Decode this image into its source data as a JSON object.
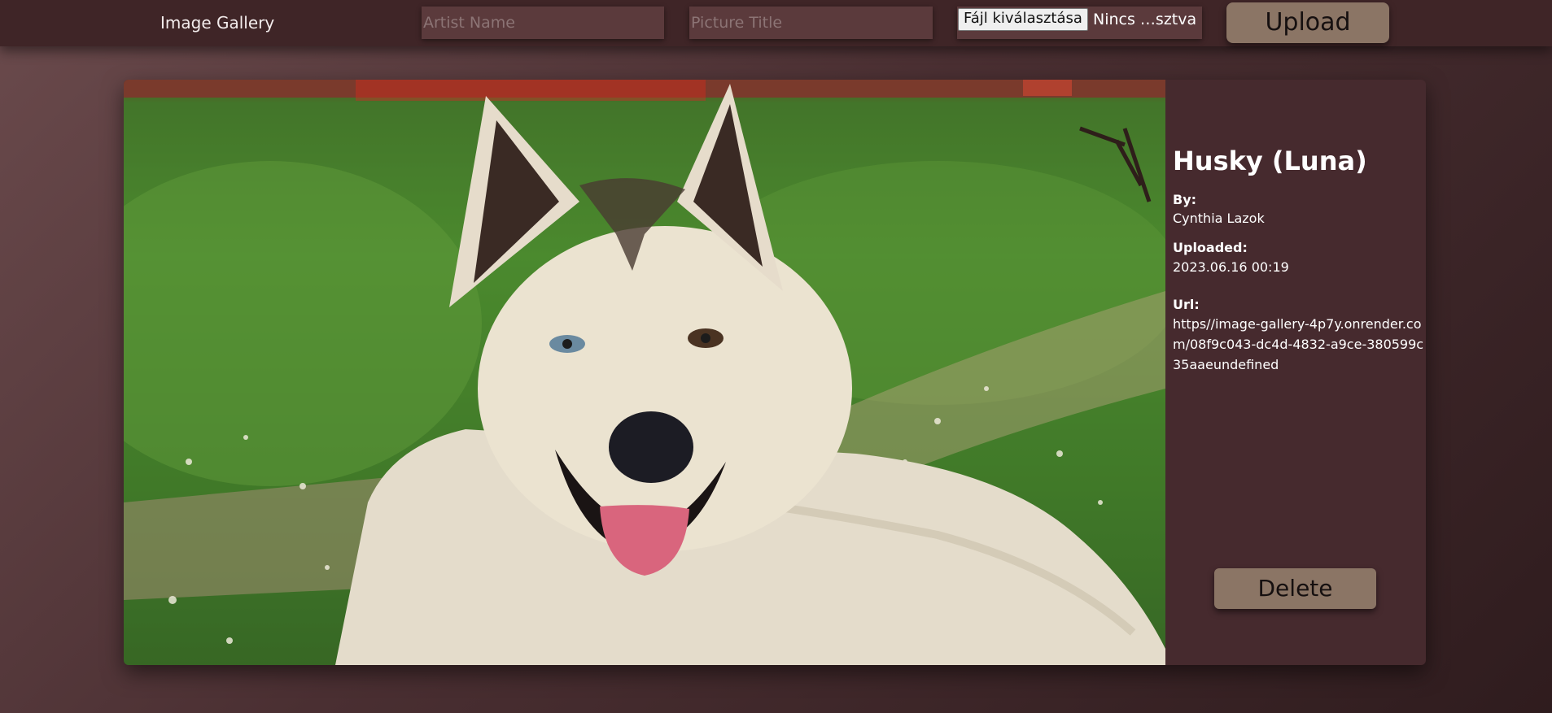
{
  "header": {
    "brand": "Image Gallery",
    "artist_placeholder": "Artist Name",
    "title_placeholder": "Picture Title",
    "file_button_label": "Fájl kiválasztása",
    "file_status": "Nincs …sztva",
    "upload_label": "Upload"
  },
  "image_card": {
    "title": "Husky (Luna)",
    "by_label": "By:",
    "artist": "Cynthia Lazok",
    "uploaded_label": "Uploaded:",
    "uploaded": "2023.06.16 00:19",
    "url_label": "Url:",
    "url": "https//image-gallery-4p7y.onrender.com/08f9c043-dc4d-4832-a9ce-380599c35aaeundefined",
    "delete_label": "Delete",
    "photo_subject": "husky-dog-photo"
  },
  "colors": {
    "topbar": "#3f2527",
    "field_bg": "#5b3a3c",
    "button_bg": "#8b7565",
    "card_bg": "#462a2e"
  }
}
